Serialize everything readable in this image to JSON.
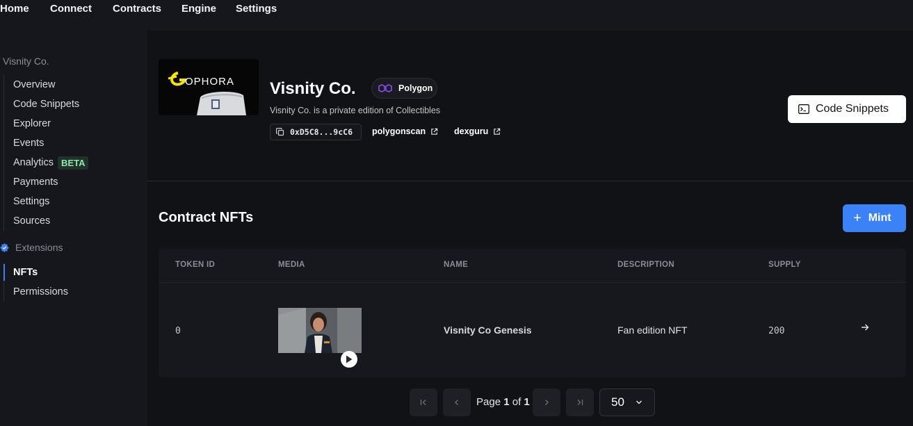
{
  "topnav": {
    "items": [
      "Home",
      "Connect",
      "Contracts",
      "Engine",
      "Settings"
    ]
  },
  "sidebar": {
    "contract_title": "Visnity Co.",
    "items": [
      "Overview",
      "Code Snippets",
      "Explorer",
      "Events",
      "Analytics",
      "Payments",
      "Settings",
      "Sources"
    ],
    "analytics_badge": "BETA",
    "extensions_label": "Extensions",
    "extension_items": [
      "NFTs",
      "Permissions"
    ],
    "active_item": "NFTs"
  },
  "header": {
    "logo_text": "OPHORA",
    "contract_name": "Visnity Co.",
    "chain": "Polygon",
    "description": "Visnity Co. is a private edition of Collectibles",
    "address": "0xD5C8...9cC6",
    "links": [
      "polygonscan",
      "dexguru"
    ],
    "code_snippets_label": "Code Snippets"
  },
  "nfts": {
    "title": "Contract NFTs",
    "mint_label": "Mint",
    "columns": [
      "TOKEN ID",
      "MEDIA",
      "NAME",
      "DESCRIPTION",
      "SUPPLY"
    ],
    "rows": [
      {
        "token_id": "0",
        "name": "Visnity Co Genesis",
        "description": "Fan edition NFT",
        "supply": "200"
      }
    ]
  },
  "pagination": {
    "prefix": "Page",
    "current": "1",
    "of": "of",
    "total": "1",
    "page_size": "50"
  },
  "colors": {
    "accent": "#3b82f6",
    "background": "#111216",
    "beta_text": "#8be8b0",
    "polygon": "#8247e5"
  }
}
